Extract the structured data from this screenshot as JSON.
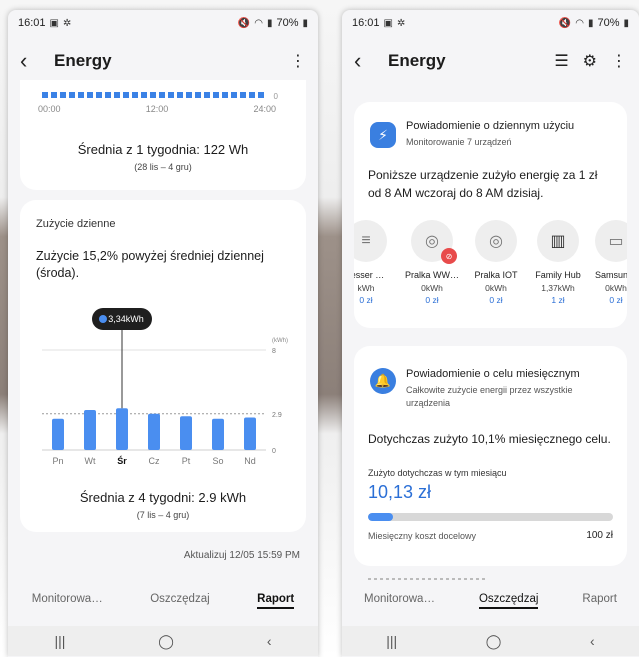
{
  "left": {
    "status": {
      "time": "16:01",
      "battery": "70%"
    },
    "appbar": {
      "title": "Energy"
    },
    "weekly": {
      "ticks": [
        "00:00",
        "12:00",
        "24:00"
      ],
      "zero": "0",
      "average": "Średnia z 1 tygodnia: 122 Wh",
      "range": "(28 lis – 4 gru)"
    },
    "daily": {
      "label": "Zużycie dzienne",
      "description": "Zużycie 15,2% powyżej średniej dziennej (środa).",
      "average": "Średnia z 4 tygodni: 2.9 kWh",
      "range": "(7 lis – 4 gru)"
    },
    "update": "Aktualizuj 12/05 15:59 PM",
    "tabs": [
      "Monitorowa…",
      "Oszczędzaj",
      "Raport"
    ],
    "active_tab": 2
  },
  "right": {
    "status": {
      "time": "16:01",
      "battery": "70%"
    },
    "appbar": {
      "title": "Energy"
    },
    "notif": {
      "title": "Powiadomienie o dziennym użyciu",
      "subtitle": "Monitorowanie 7 urządzeń",
      "body": "Poniższe urządzenie zużyło energię za 1 zł od 8 AM wczoraj do 8 AM dzisiaj.",
      "devices": [
        {
          "name": "resser …",
          "kwh": "kWh",
          "cost": "0 zł",
          "icon": "dishwasher-icon"
        },
        {
          "name": "Pralka WW…",
          "kwh": "0kWh",
          "cost": "0 zł",
          "icon": "washer-icon",
          "badge": true
        },
        {
          "name": "Pralka IOT",
          "kwh": "0kWh",
          "cost": "0 zł",
          "icon": "washer-icon"
        },
        {
          "name": "Family Hub",
          "kwh": "1,37kWh",
          "cost": "1 zł",
          "icon": "fridge-icon"
        },
        {
          "name": "Samsun…",
          "kwh": "0kWh",
          "cost": "0 zł",
          "icon": "tv-icon"
        }
      ]
    },
    "goal": {
      "title": "Powiadomienie o celu miesięcznym",
      "subtitle": "Całkowite zużycie energii przez wszystkie urządzenia",
      "body": "Dotychczas zużyto 10,1% miesięcznego celu.",
      "small": "Zużyto dotychczas w tym miesiącu",
      "amount": "10,13 zł",
      "progress": 0.101,
      "target_label": "Miesięczny koszt docelowy",
      "target_value": "100 zł"
    },
    "tabs": [
      "Monitorowa…",
      "Oszczędzaj",
      "Raport"
    ],
    "active_tab": 1
  },
  "chart_data": {
    "type": "bar",
    "categories": [
      "Pn",
      "Wt",
      "Śr",
      "Cz",
      "Pt",
      "So",
      "Nd"
    ],
    "values": [
      2.5,
      3.2,
      3.34,
      2.9,
      2.7,
      2.5,
      2.6
    ],
    "ylim": [
      0,
      8
    ],
    "yticks": [
      "8",
      "2.9",
      "0"
    ],
    "yunit": "(kWh)",
    "average": 2.9,
    "highlight_index": 2,
    "tooltip": "3,34kWh",
    "bar_color": "#4a8ef0"
  }
}
